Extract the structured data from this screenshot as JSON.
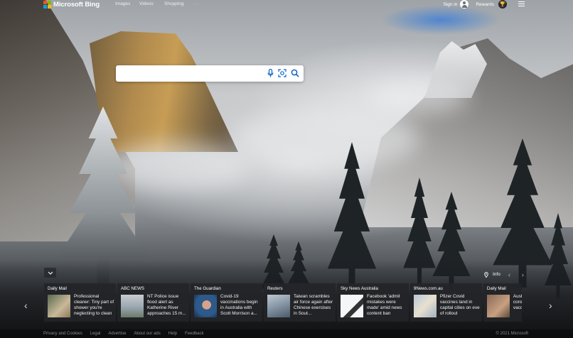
{
  "brand": {
    "name": "Microsoft Bing"
  },
  "nav": {
    "items": [
      "Images",
      "Videos",
      "Shopping"
    ],
    "more": "···"
  },
  "account": {
    "signin": "Sign in",
    "rewards": "Rewards"
  },
  "search": {
    "value": "",
    "placeholder": ""
  },
  "news": {
    "info_label": "Info",
    "cards": [
      {
        "source": "Daily Mail",
        "headline": "Professional cleaner: Tiny part of shower you're neglecting to clean",
        "thumb_colors": [
          "#5a6a4f",
          "#c9b99a"
        ]
      },
      {
        "source": "ABC NEWS",
        "headline": "NT Police issue flood alert as Katherine River approaches 15 m...",
        "thumb_colors": [
          "#c9ccd0",
          "#7a8a9a"
        ]
      },
      {
        "source": "The Guardian",
        "headline": "Covid-19 vaccinations begin in Australia with Scott Morrison a...",
        "thumb_colors": [
          "#2d5a8a",
          "#d9a38a"
        ]
      },
      {
        "source": "Reuters",
        "headline": "Taiwan scrambles air force again after Chinese exercises in Sout...",
        "thumb_colors": [
          "#6a7a8a",
          "#c0c8d0"
        ]
      },
      {
        "source": "Sky News Australia",
        "headline": "Facebook 'admit mistakes were made' amid news content ban",
        "thumb_colors": [
          "#f4f6f8",
          "#333"
        ]
      },
      {
        "source": "9News.com.au",
        "headline": "Pfizer Covid vaccines land in capital cities on eve of rollout",
        "thumb_colors": [
          "#b8c8d8",
          "#e8e0d0"
        ]
      },
      {
        "source": "Daily Mail",
        "headline": "Australia's coronavirus vaccination TODAY",
        "thumb_colors": [
          "#8a6a5a",
          "#c9a080"
        ]
      }
    ]
  },
  "footer": {
    "links": [
      "Privacy and Cookies",
      "Legal",
      "Advertise",
      "About our ads",
      "Help",
      "Feedback"
    ],
    "copyright": "© 2021 Microsoft"
  }
}
